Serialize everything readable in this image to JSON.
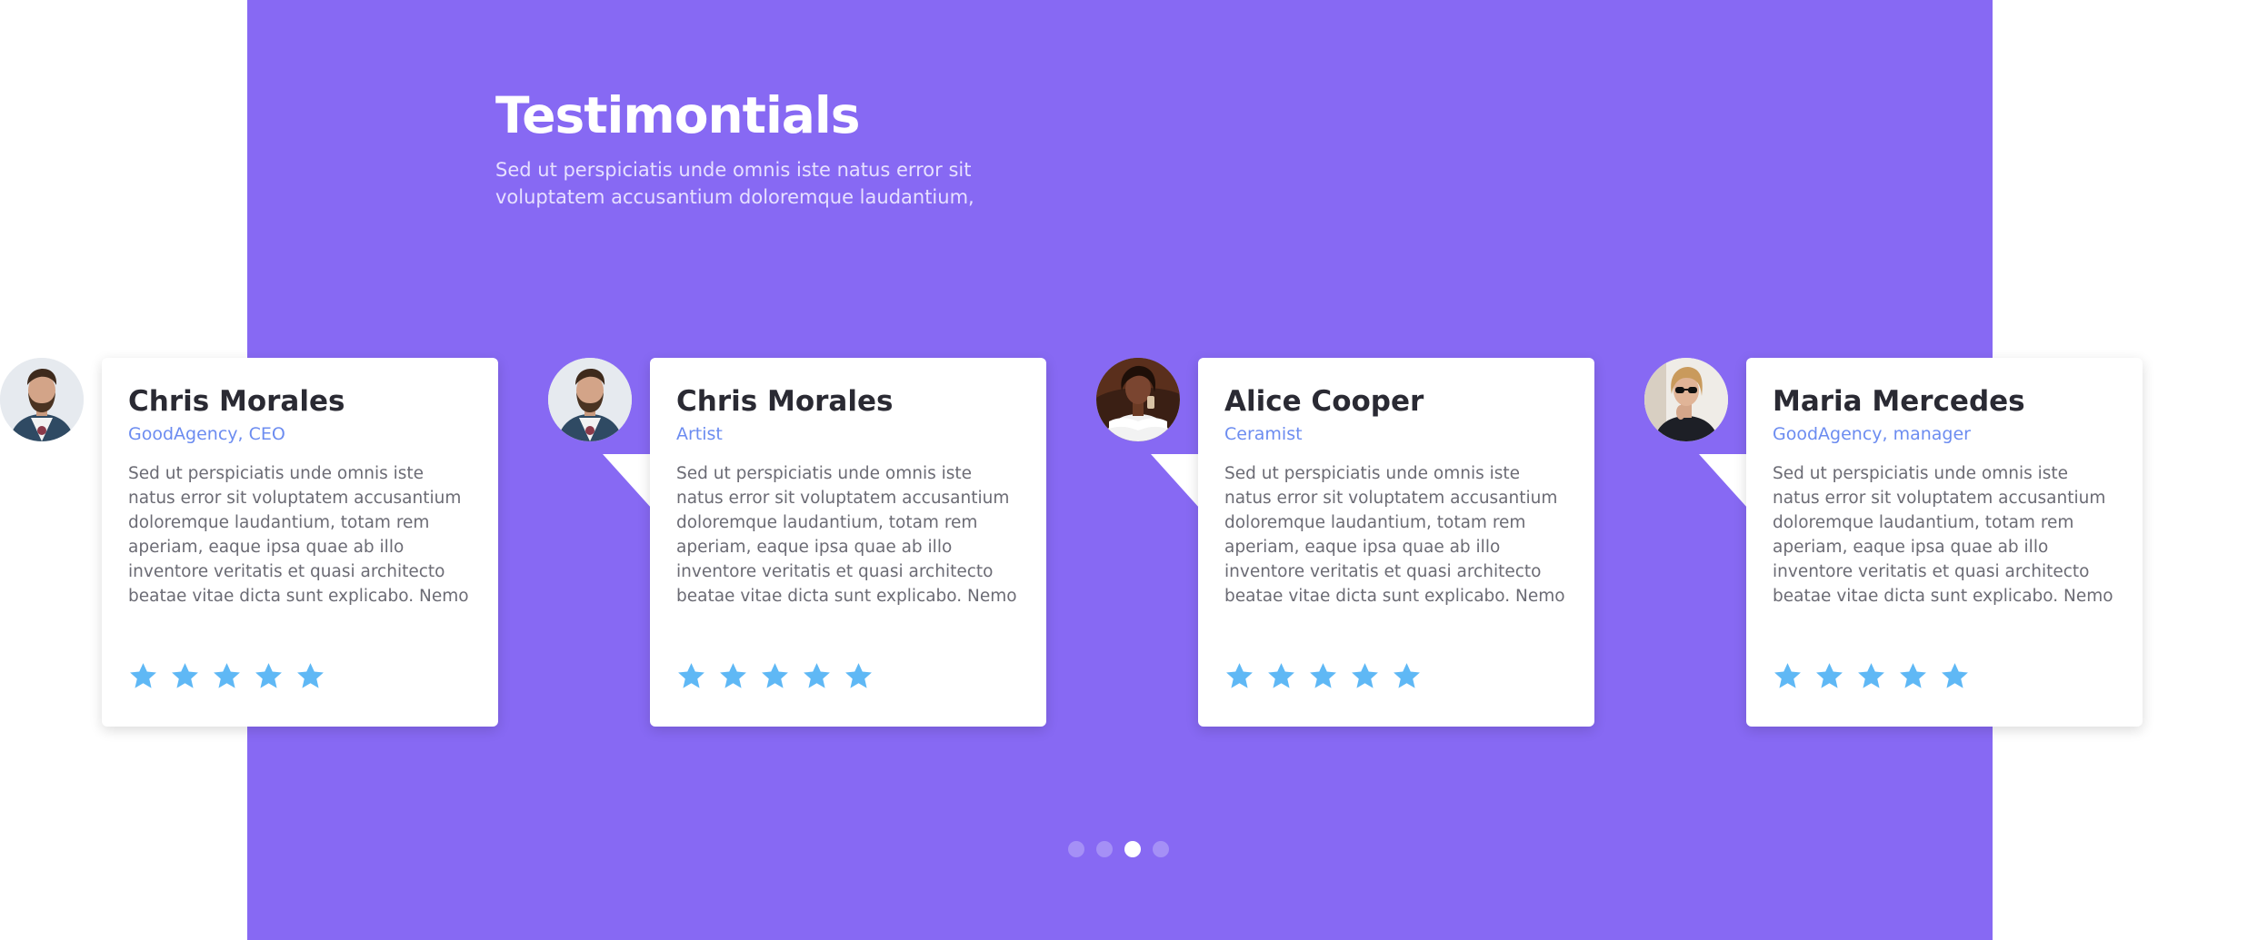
{
  "header": {
    "title": "Testimontials",
    "subtitle": "Sed ut perspiciatis unde omnis iste natus error sit voluptatem accusantium doloremque laudantium,"
  },
  "colors": {
    "panel": "#8769f3",
    "star": "#5fb8f5",
    "role": "#6c8cf0",
    "dot_inactive": "#a590f6",
    "dot_active": "#ffffff"
  },
  "testimonials": [
    {
      "name": "Chris Morales",
      "role": "GoodAgency, CEO",
      "quote": "Sed ut perspiciatis unde omnis iste natus error sit voluptatem accusantium doloremque laudantium, totam rem aperiam, eaque ipsa quae ab illo inventore veritatis et quasi architecto beatae vitae dicta sunt explicabo. Nemo enim ipsam",
      "rating": 5,
      "avatar_icon": "bearded-man-avatar"
    },
    {
      "name": "Chris Morales",
      "role": "Artist",
      "quote": "Sed ut perspiciatis unde omnis iste natus error sit voluptatem accusantium doloremque laudantium, totam rem aperiam, eaque ipsa quae ab illo inventore veritatis et quasi architecto beatae vitae dicta sunt explicabo. Nemo enim ipsam",
      "rating": 5,
      "avatar_icon": "bearded-man-avatar"
    },
    {
      "name": "Alice Cooper",
      "role": "Ceramist",
      "quote": "Sed ut perspiciatis unde omnis iste natus error sit voluptatem accusantium doloremque laudantium, totam rem aperiam, eaque ipsa quae ab illo inventore veritatis et quasi architecto beatae vitae dicta sunt explicabo. Nemo enim ipsam",
      "rating": 5,
      "avatar_icon": "woman-dark-avatar"
    },
    {
      "name": "Maria Mercedes",
      "role": "GoodAgency, manager",
      "quote": "Sed ut perspiciatis unde omnis iste natus error sit voluptatem accusantium doloremque laudantium, totam rem aperiam, eaque ipsa quae ab illo inventore veritatis et quasi architecto beatae vitae dicta sunt explicabo. Nemo enim ipsam",
      "rating": 5,
      "avatar_icon": "woman-sunglasses-avatar"
    }
  ],
  "pagination": {
    "count": 4,
    "active_index": 2
  }
}
